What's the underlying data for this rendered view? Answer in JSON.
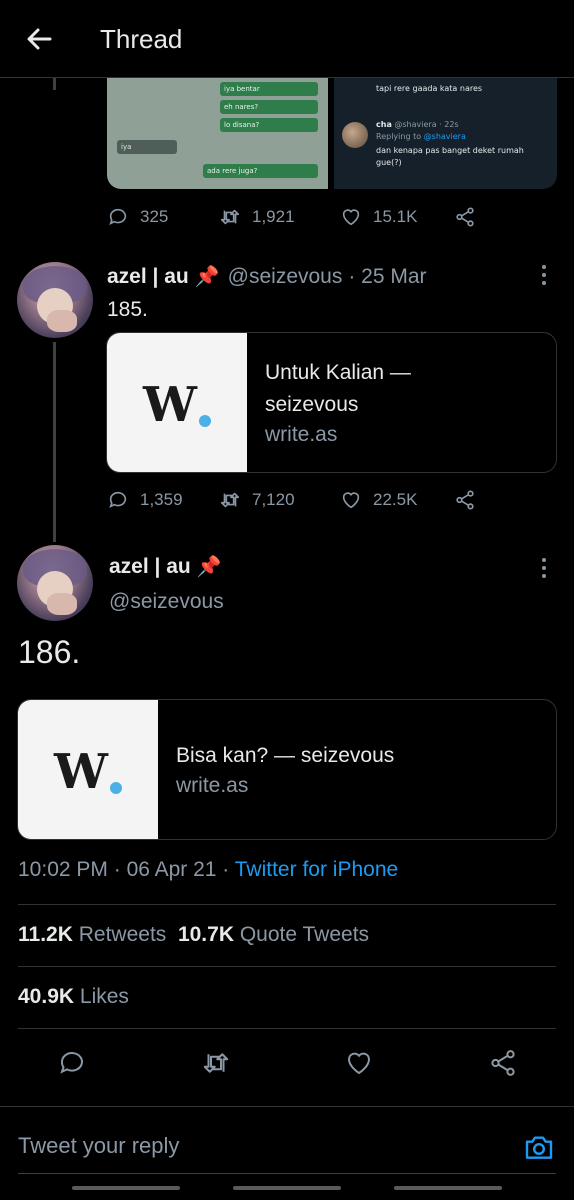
{
  "header": {
    "title": "Thread"
  },
  "media": {
    "chat_left": [
      {
        "text": "iya bentar"
      },
      {
        "text": "eh nares?"
      },
      {
        "text": "lo disana?"
      },
      {
        "text": "iya"
      },
      {
        "text": "ada rere juga?"
      }
    ],
    "right_top_text": "tapi rere gaada kata nares",
    "right_reply_name": "cha",
    "right_reply_handle": "@shaviera · 22s",
    "right_replying": "Replying to",
    "right_replying_to": "@shaviera",
    "right_reply_text_1": "dan kenapa pas banget deket rumah",
    "right_reply_text_2": "gue(?)"
  },
  "tweet1_actions": {
    "replies": "325",
    "retweets": "1,921",
    "likes": "15.1K"
  },
  "tweet2": {
    "name": "azel | au",
    "pin": "📌",
    "handle": "@seizevous",
    "date": "· 25 Mar",
    "text": "185.",
    "card": {
      "title_line1": "Untuk Kalian —",
      "title_line2": "seizevous",
      "domain": "write.as"
    },
    "actions": {
      "replies": "1,359",
      "retweets": "7,120",
      "likes": "22.5K"
    }
  },
  "tweet3": {
    "name": "azel | au",
    "pin": "📌",
    "handle": "@seizevous",
    "text": "186.",
    "card": {
      "title": "Bisa kan? — seizevous",
      "domain": "write.as"
    },
    "time": "10:02 PM",
    "date": "06 Apr 21",
    "source": "Twitter for iPhone",
    "retweets_count": "11.2K",
    "retweets_label": "Retweets",
    "quotes_count": "10.7K",
    "quotes_label": "Quote Tweets",
    "likes_count": "40.9K",
    "likes_label": "Likes"
  },
  "reply": {
    "placeholder": "Tweet your reply"
  },
  "colors": {
    "accent": "#1d9bf0",
    "muted": "#8b98a5",
    "background": "#000000"
  }
}
